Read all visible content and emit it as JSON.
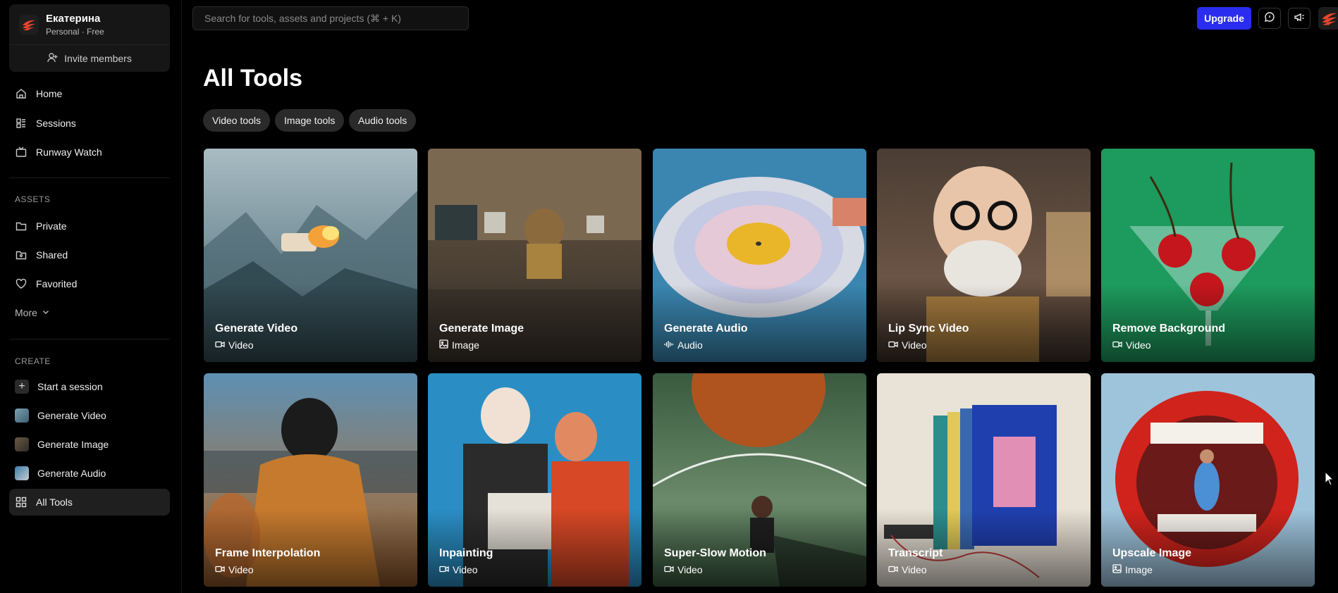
{
  "workspace": {
    "name": "Екатерина",
    "plan": "Personal · Free",
    "invite_label": "Invite members"
  },
  "sidebar": {
    "nav": [
      {
        "label": "Home",
        "icon": "home-icon"
      },
      {
        "label": "Sessions",
        "icon": "sessions-icon"
      },
      {
        "label": "Runway Watch",
        "icon": "tv-icon"
      }
    ],
    "assets_label": "ASSETS",
    "assets": [
      {
        "label": "Private",
        "icon": "folder-icon"
      },
      {
        "label": "Shared",
        "icon": "shared-folder-icon"
      },
      {
        "label": "Favorited",
        "icon": "heart-icon"
      }
    ],
    "more_label": "More",
    "create_label": "CREATE",
    "create": [
      {
        "label": "Start a session",
        "icon": "plus-icon"
      },
      {
        "label": "Generate Video",
        "icon": "video-thumb"
      },
      {
        "label": "Generate Image",
        "icon": "image-thumb"
      },
      {
        "label": "Generate Audio",
        "icon": "audio-thumb"
      },
      {
        "label": "All Tools",
        "icon": "grid-icon",
        "active": true
      }
    ]
  },
  "search": {
    "placeholder": "Search for tools, assets and projects (⌘ + K)"
  },
  "topbar": {
    "upgrade_label": "Upgrade"
  },
  "main": {
    "title": "All Tools",
    "filters": [
      "Video tools",
      "Image tools",
      "Audio tools"
    ],
    "tools": [
      {
        "title": "Generate Video",
        "type": "Video",
        "icon": "video-icon"
      },
      {
        "title": "Generate Image",
        "type": "Image",
        "icon": "image-icon"
      },
      {
        "title": "Generate Audio",
        "type": "Audio",
        "icon": "audio-icon"
      },
      {
        "title": "Lip Sync Video",
        "type": "Video",
        "icon": "video-icon"
      },
      {
        "title": "Remove Background",
        "type": "Video",
        "icon": "video-icon"
      },
      {
        "title": "Frame Interpolation",
        "type": "Video",
        "icon": "video-icon"
      },
      {
        "title": "Inpainting",
        "type": "Video",
        "icon": "video-icon"
      },
      {
        "title": "Super-Slow Motion",
        "type": "Video",
        "icon": "video-icon"
      },
      {
        "title": "Transcript",
        "type": "Video",
        "icon": "video-icon"
      },
      {
        "title": "Upscale Image",
        "type": "Image",
        "icon": "image-icon"
      }
    ]
  },
  "colors": {
    "accent": "#2a2df0",
    "background": "#000000",
    "sidebar_active": "#1f1f1f"
  }
}
